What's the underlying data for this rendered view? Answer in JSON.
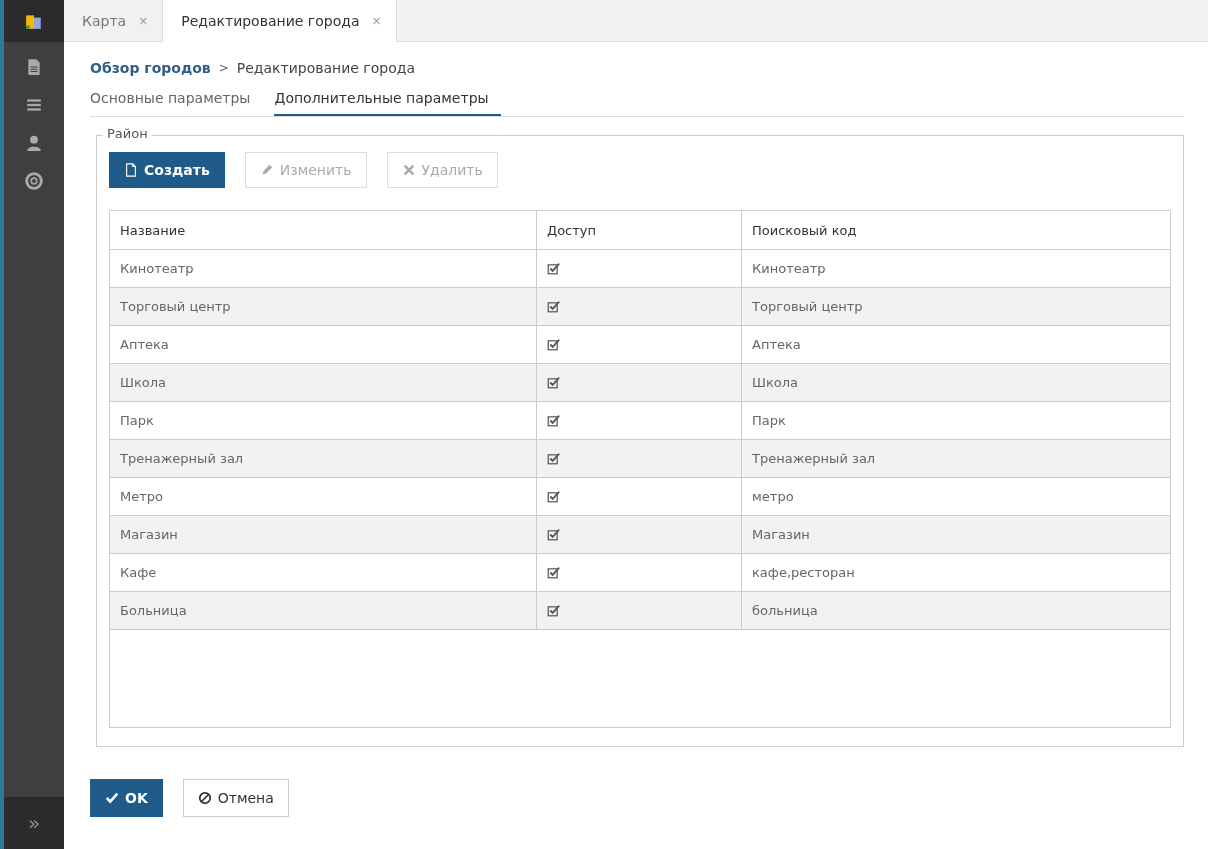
{
  "sidebar": {
    "items": [
      {
        "kind": "logo"
      },
      {
        "kind": "document"
      },
      {
        "kind": "list"
      },
      {
        "kind": "user"
      },
      {
        "kind": "help"
      }
    ],
    "expand_label": "»"
  },
  "tabs": [
    {
      "label": "Карта",
      "close": "×",
      "selected": false
    },
    {
      "label": "Редактирование города",
      "close": "×",
      "selected": true
    }
  ],
  "breadcrumb": {
    "link": "Обзор городов",
    "separator": ">",
    "current": "Редактирование города"
  },
  "sub_tabs": [
    {
      "label": "Основные параметры",
      "selected": false
    },
    {
      "label": "Дополнительные параметры",
      "selected": true
    }
  ],
  "group": {
    "legend": "Район",
    "buttons": [
      {
        "label": "Создать",
        "kind": "file",
        "disabled": false,
        "primary": true
      },
      {
        "label": "Изменить",
        "kind": "pencil",
        "disabled": true,
        "primary": false
      },
      {
        "label": "Удалить",
        "kind": "cross",
        "disabled": true,
        "primary": false
      }
    ],
    "table": {
      "columns": [
        "Название",
        "Доступ",
        "Поисковый код"
      ],
      "rows": [
        {
          "name": "Кинотеатр",
          "access": true,
          "code": "Кинотеатр"
        },
        {
          "name": "Торговый центр",
          "access": true,
          "code": "Торговый центр"
        },
        {
          "name": "Аптека",
          "access": true,
          "code": "Аптека"
        },
        {
          "name": "Школа",
          "access": true,
          "code": "Школа"
        },
        {
          "name": "Парк",
          "access": true,
          "code": "Парк"
        },
        {
          "name": "Тренажерный зал",
          "access": true,
          "code": "Тренажерный зал"
        },
        {
          "name": "Метро",
          "access": true,
          "code": "метро"
        },
        {
          "name": "Магазин",
          "access": true,
          "code": "Магазин"
        },
        {
          "name": "Кафе",
          "access": true,
          "code": "кафе,ресторан"
        },
        {
          "name": "Больница",
          "access": true,
          "code": "больница"
        }
      ]
    }
  },
  "footer_buttons": [
    {
      "label": "OK",
      "kind": "check",
      "primary": true
    },
    {
      "label": "Отмена",
      "kind": "ban",
      "primary": false
    }
  ]
}
